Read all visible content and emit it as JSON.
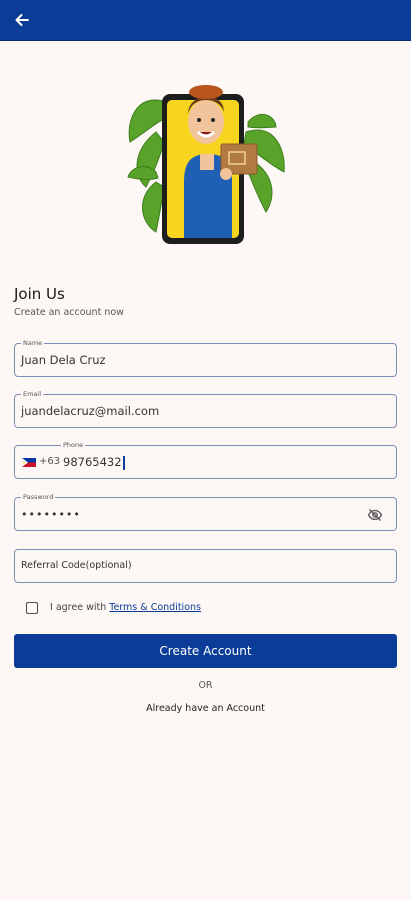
{
  "appbar": {
    "back_icon": "arrow-left-icon",
    "color": "#0b3d98"
  },
  "hero": {
    "image": "delivery-man-illustration"
  },
  "header": {
    "title": "Join Us",
    "subtitle": "Create an account now"
  },
  "form": {
    "name": {
      "label": "Name",
      "value": "Juan Dela Cruz"
    },
    "email": {
      "label": "Email",
      "value": "juandelacruz@mail.com"
    },
    "phone": {
      "label": "Phone",
      "country_code": "+63",
      "value": "98765432",
      "flag_icon": "philippines-flag-icon"
    },
    "password": {
      "label": "Password",
      "value": "••••••••",
      "toggle_icon": "eye-off-icon"
    },
    "referral": {
      "placeholder": "Referral Code(optional)"
    }
  },
  "terms": {
    "prefix": "I agree with ",
    "link": "Terms & Conditions",
    "checked": false
  },
  "actions": {
    "create_label": "Create Account",
    "or_label": "OR",
    "login_label": "Already have an Account"
  },
  "colors": {
    "primary": "#0b3d98",
    "background": "#fdf8f6"
  }
}
